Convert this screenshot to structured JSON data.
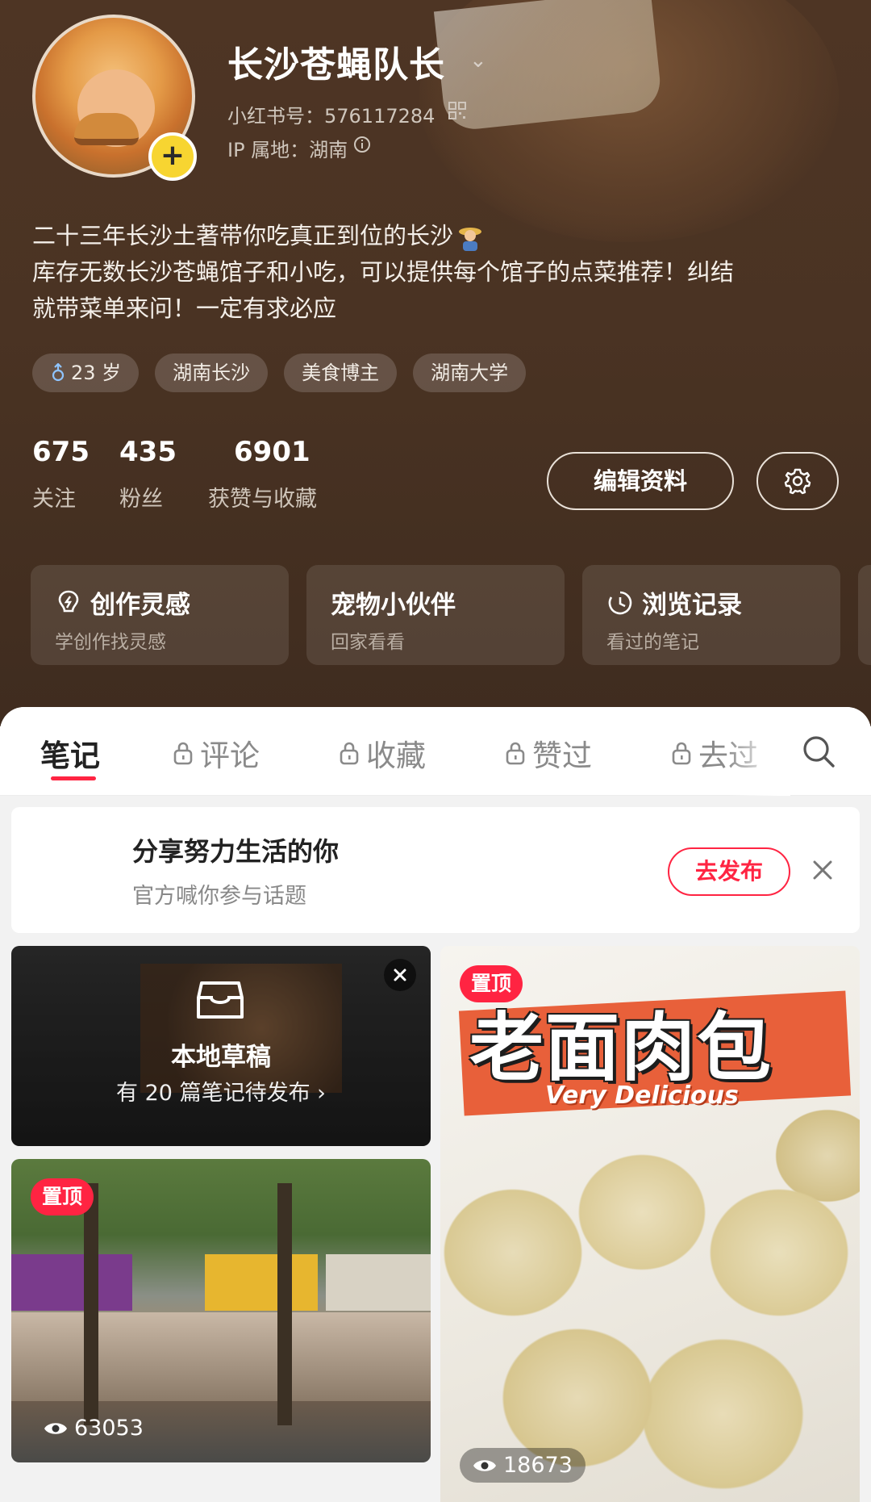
{
  "profile": {
    "name": "长沙苍蝇队长",
    "redbook_id": "小红书号：576117284",
    "ip_location": "IP 属地：湖南",
    "bio_line1": "二十三年长沙土著带你吃真正到位的长沙",
    "bio_line2": "库存无数长沙苍蝇馆子和小吃，可以提供每个馆子的点菜推荐！纠结",
    "bio_line3": "就带菜单来问！一定有求必应",
    "tags": [
      {
        "icon": "male-icon",
        "label": "23 岁"
      },
      {
        "label": "湖南长沙"
      },
      {
        "label": "美食博主"
      },
      {
        "label": "湖南大学"
      }
    ]
  },
  "stats": [
    {
      "value": "675",
      "label": "关注"
    },
    {
      "value": "435",
      "label": "粉丝"
    },
    {
      "value": "6901",
      "label": "获赞与收藏"
    }
  ],
  "actions": {
    "edit_profile": "编辑资料",
    "settings_icon": "gear-icon"
  },
  "cards": [
    {
      "icon": "lightbulb-icon",
      "title": "创作灵感",
      "subtitle": "学创作找灵感"
    },
    {
      "title": "宠物小伙伴",
      "subtitle": "回家看看"
    },
    {
      "icon": "clock-icon",
      "title": "浏览记录",
      "subtitle": "看过的笔记"
    }
  ],
  "tabs": [
    {
      "label": "笔记",
      "active": true
    },
    {
      "label": "评论",
      "locked": true
    },
    {
      "label": "收藏",
      "locked": true
    },
    {
      "label": "赞过",
      "locked": true
    },
    {
      "label": "去过",
      "locked": true
    }
  ],
  "promo": {
    "title": "分享努力生活的你",
    "subtitle": "官方喊你参与话题",
    "button": "去发布"
  },
  "draft": {
    "title": "本地草稿",
    "subtitle": "有 20 篇笔记待发布 ›"
  },
  "notes": [
    {
      "pinned_label": "置顶",
      "views": "63053"
    },
    {
      "pinned_label": "置顶",
      "views": "18673",
      "cover_title": "老面肉包",
      "cover_subtitle": "Very Delicious"
    }
  ],
  "colors": {
    "accent": "#ff2442",
    "header_bg": "#4a3323",
    "plus_yellow": "#f7d531"
  }
}
